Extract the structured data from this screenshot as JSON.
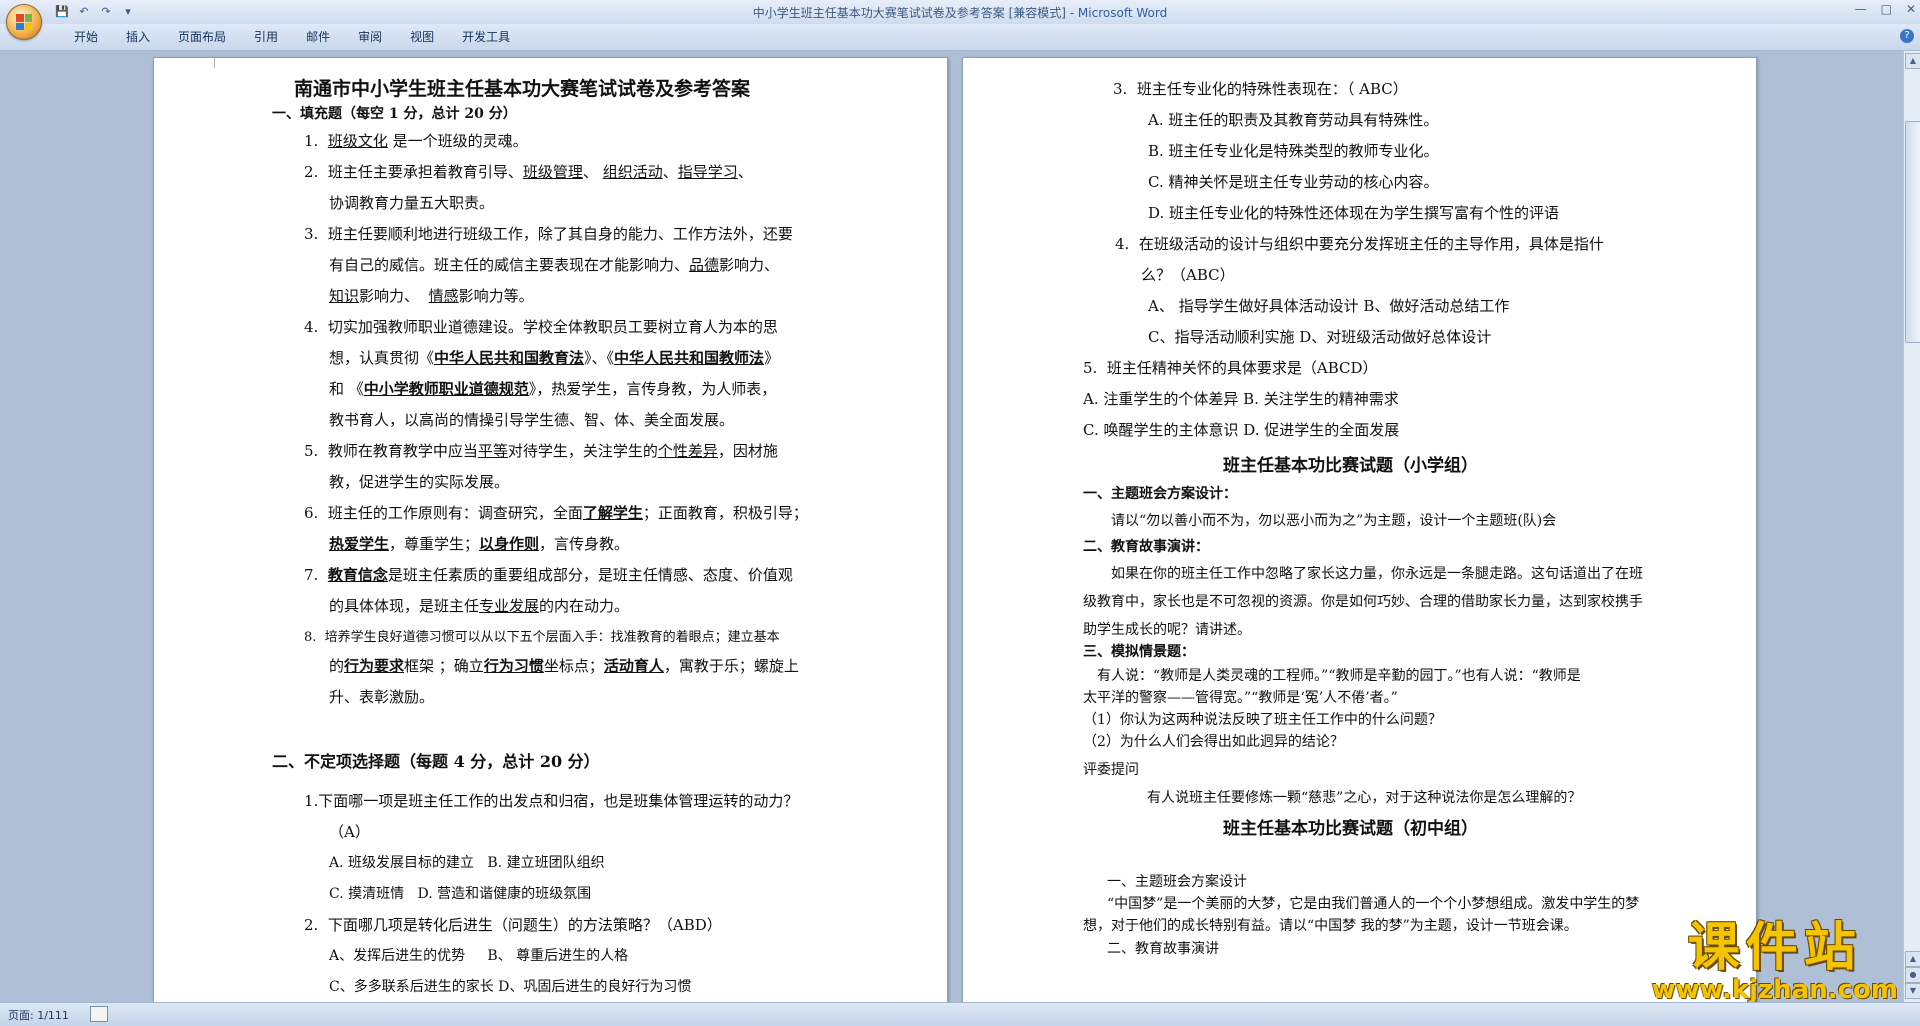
{
  "window": {
    "title": "中小学生班主任基本功大赛笔试试卷及参考答案 [兼容模式] - ",
    "app_name": "Microsoft Word",
    "controls": [
      "—",
      "□",
      "✕"
    ]
  },
  "ribbon": {
    "tabs": [
      "开始",
      "插入",
      "页面布局",
      "引用",
      "邮件",
      "审阅",
      "视图",
      "开发工具"
    ],
    "help": "?"
  },
  "page1": {
    "title": "南通市中小学生班主任基本功大赛笔试试卷及参考答案",
    "s1_heading": "一、填充题（每空 1 分，总计 20 分）",
    "q1": {
      "num": "1.",
      "blank": "班级文化",
      "text": "是一个班级的灵魂。"
    },
    "q2": {
      "num": "2.",
      "a": "班主任主要承担着教育引导、",
      "b1": "班级管理",
      "sep1": "、",
      "b2": "组织活动",
      "sep2": "、",
      "b3": "指导学习",
      "c": "、",
      "line2": "协调教育力量五大职责。"
    },
    "q3": {
      "num": "3.",
      "line1": "班主任要顺利地进行班级工作，除了其自身的能力、工作方法外，还要",
      "line2a": "有自己的威信。班主任的威信主要表现在才能影响力、",
      "b1": "品德",
      "line2b": "影响力、",
      "b2": "知识",
      "line3a": "影响力、",
      "b3": "情感",
      "line3b": "影响力等。"
    },
    "q4": {
      "num": "4.",
      "line1": "切实加强教师职业道德建设。学校全体教职员工要树立育人为本的思",
      "line2a": "想，认真贯彻《",
      "b1": "中华人民共和国教育法",
      "line2b": "》、《",
      "b2": "中华人民共和国教师法",
      "line2c": "》",
      "line3a": "和 《",
      "b3": "中小学教师职业道德规范",
      "line3b": "》，热爱学生，言传身教，为人师表，",
      "line4": "教书育人，以高尚的情操引导学生德、智、体、美全面发展。"
    },
    "q5": {
      "num": "5.",
      "a": "教师在教育教学中应当",
      "b1": "平等",
      "b": "对待学生，关注学生的",
      "b2": "个性差异",
      "c": "，因材施",
      "line2": "教，促进学生的实际发展。"
    },
    "q6": {
      "num": "6.",
      "a": "班主任的工作原则有：调查研究，全面",
      "b1": "了解学生",
      "b": "；正面教育，积极引导；",
      "b2": "热爱学生",
      "c": "，尊重学生；",
      "b3": "以身作则",
      "d": "，言传身教。"
    },
    "q7": {
      "num": "7.",
      "b1": "教育信念",
      "a": "是班主任素质的重要组成部分，是班主任情感、态度、价值观",
      "line2a": "的具体体现，是班主任",
      "b2": "专业发展",
      "line2b": "的内在动力。"
    },
    "q8": {
      "num": "8.",
      "line1": "培养学生良好道德习惯可以从以下五个层面入手：找准教育的着眼点；建立基本",
      "line2a": "的",
      "b1": "行为要求",
      "line2b": "框架 ；确立",
      "b2": "行为习惯",
      "line2c": "坐标点；",
      "b3": "活动育人",
      "line2d": "，寓教于乐；螺旋上",
      "line3": "升、表彰激励。"
    },
    "s2_heading": "二、不定项选择题（每题 4 分，总计 20 分）",
    "m1": {
      "line1": "1.下面哪一项是班主任工作的出发点和归宿，也是班集体管理运转的动力？",
      "ans": "（A）",
      "optA": "A. 班级发展目标的建立",
      "optB": "B. 建立班团队组织",
      "optC": "C. 摸清班情",
      "optD": "D. 营造和谐健康的班级氛围"
    },
    "m2": {
      "num": "2.",
      "line1": "下面哪几项是转化后进生（问题生）的方法策略？（ABD）",
      "optA": "A、发挥后进生的优势",
      "optB": "B、 尊重后进生的人格",
      "optCD": "C、多多联系后进生的家长   D、巩固后进生的良好行为习惯"
    }
  },
  "page2": {
    "m3": {
      "num": "3.",
      "line1": "班主任专业化的特殊性表现在：（ ABC）",
      "optA": "A.  班主任的职责及其教育劳动具有特殊性。",
      "optB": "B.  班主任专业化是特殊类型的教师专业化。",
      "optC": "C.  精神关怀是班主任专业劳动的核心内容。",
      "optD": "D.  班主任专业化的特殊性还体现在为学生撰写富有个性的评语"
    },
    "m4": {
      "num": "4.",
      "line1": "在班级活动的设计与组织中要充分发挥班主任的主导作用，具体是指什",
      "line2": "么？（ABC）",
      "optAB": "A、 指导学生做好具体活动设计      B、做好活动总结工作",
      "optCD": "C、指导活动顺利实施   D、对班级活动做好总体设计"
    },
    "m5": {
      "num": "5.",
      "line1": "班主任精神关怀的具体要求是（ABCD）",
      "optAB": "A.  注重学生的个体差异 B.   关注学生的精神需求",
      "optCD": "C.  唤醒学生的主体意识 D.   促进学生的全面发展"
    },
    "primary_title": "班主任基本功比赛试题（小学组）",
    "p1_heading": "一、主题班会方案设计：",
    "p1_text": "请以“勿以善小而不为，勿以恶小而为之”为主题，设计一个主题班(队)会",
    "p2_heading": "二、教育故事演讲：",
    "p2_line1": "如果在你的班主任工作中忽略了家长这力量，你永远是一条腿走路。这句话道出了在班",
    "p2_line2": "级教育中，家长也是不可忽视的资源。你是如何巧妙、合理的借助家长力量，达到家校携手",
    "p2_line3": "助学生成长的呢？请讲述。",
    "p3_heading": "三、模拟情景题：",
    "p3_line1": "有人说：“教师是人类灵魂的工程师。”“教师是辛勤的园丁。”也有人说：“教师是",
    "p3_line2": "太平洋的警察——管得宽。”“教师是‘冤’人不倦’者。”",
    "p3_q1": "（1）你认为这两种说法反映了班主任工作中的什么问题？",
    "p3_q2": "（2）为什么人们会得出如此迥异的结论？",
    "judge_q_label": "评委提问",
    "judge_q": "有人说班主任要修炼一颗“慈悲”之心，对于这种说法你是怎么理解的？",
    "middle_title": "班主任基本功比赛试题（初中组）",
    "m_s1_heading": "一、主题班会方案设计",
    "m_s1_line1": "“中国梦”是一个美丽的大梦，它是由我们普通人的一个个小梦想组成。激发中学生的梦",
    "m_s1_line2": "想，对于他们的成长特别有益。请以“中国梦 我的梦”为主题，设计一节班会课。",
    "m_s2_heading": "二、教育故事演讲"
  },
  "status": {
    "page": "页面: 1/111"
  },
  "watermark": {
    "big": "课件站",
    "url": "www.kjzhan.com"
  },
  "colors": {
    "title_app": "#2f5f9e",
    "ribbon_bg": "#dfe9f6",
    "doc_bg": "#aebfd6",
    "watermark": "#f5c400"
  }
}
